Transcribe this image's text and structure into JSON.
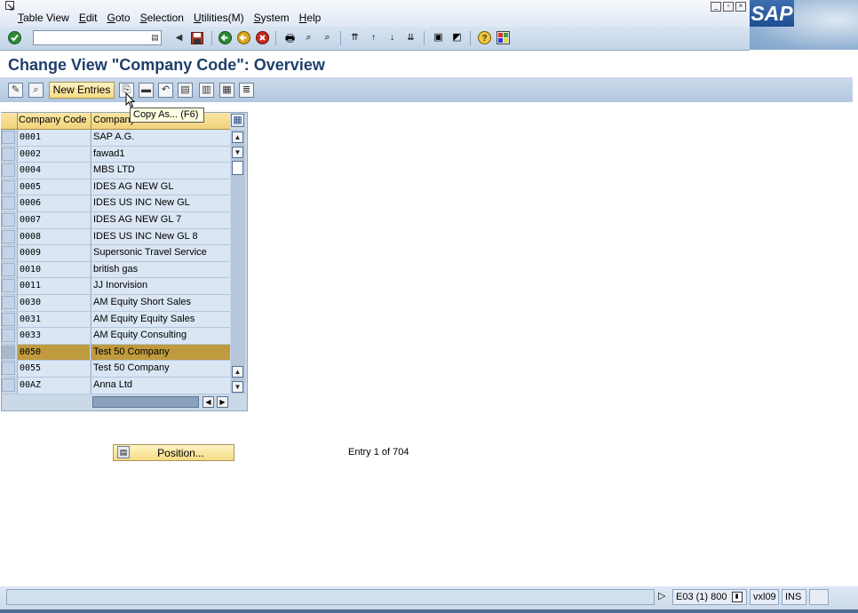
{
  "menu": {
    "items": [
      "Table View",
      "Edit",
      "Goto",
      "Selection",
      "Utilities(M)",
      "System",
      "Help"
    ]
  },
  "brand": {
    "logo_text": "SAP"
  },
  "standard_toolbar": {
    "command_field_value": "",
    "icons": [
      "enter-icon",
      "back-icon",
      "save-icon",
      "back-nav-icon",
      "exit-icon",
      "cancel-icon",
      "print-icon",
      "find-icon",
      "find-next-icon",
      "first-page-icon",
      "previous-page-icon",
      "next-page-icon",
      "last-page-icon",
      "create-session-icon",
      "shortcut-icon",
      "help-icon",
      "layout-icon"
    ]
  },
  "page": {
    "title": "Change View \"Company Code\": Overview"
  },
  "app_toolbar": {
    "new_entries_label": "New Entries",
    "tooltip": "Copy As...   (F6)"
  },
  "table": {
    "columns": [
      "Company Code",
      "Company Name"
    ],
    "rows": [
      {
        "code": "0001",
        "name": "SAP A.G."
      },
      {
        "code": "0002",
        "name": "fawad1"
      },
      {
        "code": "0004",
        "name": "MBS LTD"
      },
      {
        "code": "0005",
        "name": "IDES AG NEW GL"
      },
      {
        "code": "0006",
        "name": "IDES US INC New GL"
      },
      {
        "code": "0007",
        "name": "IDES AG NEW GL 7"
      },
      {
        "code": "0008",
        "name": "IDES US INC New GL 8"
      },
      {
        "code": "0009",
        "name": "Supersonic Travel Service"
      },
      {
        "code": "0010",
        "name": "british gas"
      },
      {
        "code": "0011",
        "name": "JJ Inorvision"
      },
      {
        "code": "0030",
        "name": "AM Equity Short Sales"
      },
      {
        "code": "0031",
        "name": "AM Equity Equity Sales"
      },
      {
        "code": "0033",
        "name": "AM Equity Consulting"
      },
      {
        "code": "0050",
        "name": "Test 50 Company"
      },
      {
        "code": "0055",
        "name": "Test 50 Company"
      },
      {
        "code": "00AZ",
        "name": "Anna Ltd"
      }
    ],
    "selected_row_index": 13
  },
  "position_button_label": "Position...",
  "entry_info": "Entry 1 of 704",
  "status": {
    "system": "E03 (1) 800",
    "server": "vxl09",
    "mode": "INS"
  },
  "colors": {
    "title": "#1f3f6c",
    "selected_row": "#c09a3e",
    "header": "#f1d27a"
  }
}
